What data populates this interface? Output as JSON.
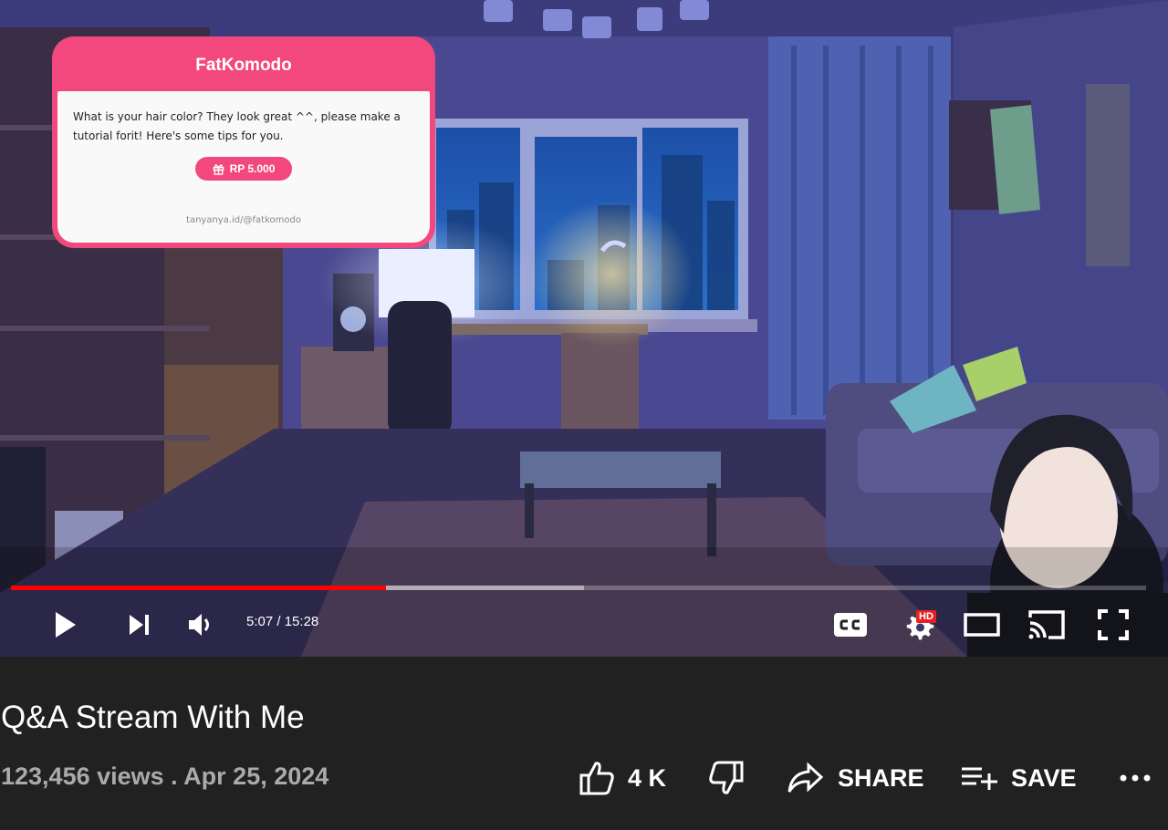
{
  "video": {
    "title": "Q&A Stream With Me",
    "views": "123,456 views",
    "separator": " . ",
    "date": "Apr 25, 2024"
  },
  "player": {
    "time_current": "5:07",
    "time_separator": " / ",
    "time_total": "15:28",
    "played_fraction": 0.33,
    "buffered_fraction": 0.505,
    "hd_badge": "HD",
    "colors": {
      "played": "#ff0000",
      "hd_badge": "#e52222"
    }
  },
  "overlay": {
    "donor_name": "FatKomodo",
    "message": "What is your hair color? They look great ^^, please make a tutorial forit! Here's some tips for you.",
    "amount": "RP 5.000",
    "link": "tanyanya.id/@fatkomodo",
    "colors": {
      "card": "#f2487e"
    }
  },
  "actions": {
    "like_count": "4 K",
    "share_label": "SHARE",
    "save_label": "SAVE"
  },
  "icons": [
    "play-icon",
    "next-icon",
    "volume-icon",
    "captions-icon",
    "settings-icon",
    "theater-icon",
    "cast-icon",
    "fullscreen-icon",
    "thumbs-up-icon",
    "thumbs-down-icon",
    "share-icon",
    "playlist-add-icon",
    "more-icon",
    "gift-icon"
  ]
}
